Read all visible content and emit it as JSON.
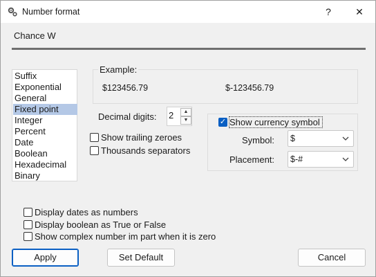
{
  "window": {
    "title": "Number format",
    "help_label": "?",
    "close_label": "✕"
  },
  "document": {
    "name": "Chance W"
  },
  "format_list": {
    "items": [
      "Suffix",
      "Exponential",
      "General",
      "Fixed point",
      "Integer",
      "Percent",
      "Date",
      "Boolean",
      "Hexadecimal",
      "Binary"
    ],
    "selected": "Fixed point"
  },
  "example": {
    "label": "Example:",
    "positive": "$123456.79",
    "negative": "$-123456.79"
  },
  "decimal_digits": {
    "label": "Decimal digits:",
    "value": "2"
  },
  "options": {
    "trailing_zeroes": {
      "label": "Show trailing zeroes",
      "checked": false
    },
    "thousands_separators": {
      "label": "Thousands separators",
      "checked": false
    }
  },
  "currency": {
    "show_label": "Show currency symbol",
    "show_checked": true,
    "symbol_label": "Symbol:",
    "symbol_value": "$",
    "placement_label": "Placement:",
    "placement_value": "$-#"
  },
  "bottom_options": {
    "dates_as_numbers": {
      "label": "Display dates as numbers",
      "checked": false
    },
    "boolean_true_false": {
      "label": "Display boolean as True or False",
      "checked": false
    },
    "complex_im_part": {
      "label": "Show complex number im part when it is zero",
      "checked": false
    }
  },
  "buttons": {
    "apply": "Apply",
    "set_default": "Set Default",
    "cancel": "Cancel"
  },
  "colors": {
    "accent": "#0a5fc3",
    "selection": "#b4c8e6"
  }
}
